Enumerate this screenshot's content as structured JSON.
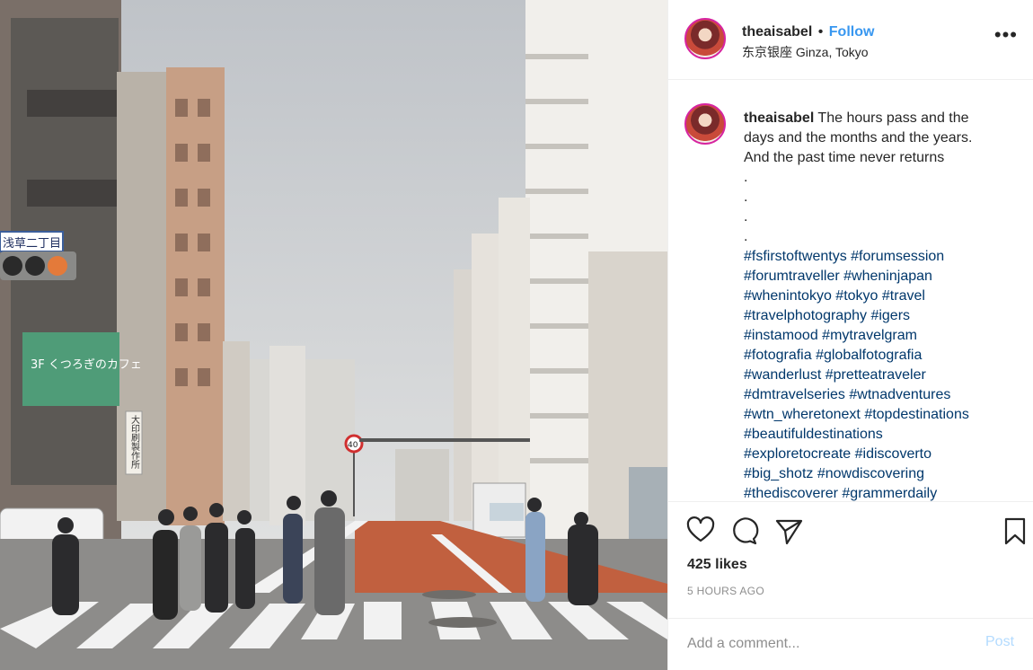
{
  "post": {
    "username": "theaisabel",
    "follow_label": "Follow",
    "separator": "•",
    "location": "东京银座 Ginza, Tokyo",
    "more_glyph": "•••",
    "photo": {
      "street_sign": "浅草二丁目",
      "cafe_sign": "3F くつろぎのカフェ",
      "vertical_sign": "大印刷製作所",
      "speed_sign": "40"
    },
    "caption": {
      "username": "theaisabel",
      "lines": [
        "The hours pass and the",
        "days and the months and the years.",
        "And the past time never returns",
        ".",
        ".",
        ".",
        "."
      ],
      "hashtag_lines": [
        [
          "#fsfirstoftwentys",
          "#forumsession"
        ],
        [
          "#forumtraveller",
          "#wheninjapan"
        ],
        [
          "#whenintokyo",
          "#tokyo",
          "#travel"
        ],
        [
          "#travelphotography",
          "#igers"
        ],
        [
          "#instamood",
          "#mytravelgram"
        ],
        [
          "#fotografia",
          "#globalfotografia"
        ],
        [
          "#wanderlust",
          "#pretteatraveler"
        ],
        [
          "#dmtravelseries",
          "#wtnadventures"
        ],
        [
          "#wtn_wheretonext",
          "#topdestinations"
        ],
        [
          "#beautifuldestinations"
        ],
        [
          "#exploretocreate",
          "#idiscoverto"
        ],
        [
          "#big_shotz",
          "#nowdiscovering"
        ],
        [
          "#thediscoverer",
          "#grammerdaily"
        ]
      ]
    },
    "likes": "425 likes",
    "time_ago": "5 HOURS AGO",
    "comment": {
      "placeholder": "Add a comment...",
      "post_label": "Post"
    }
  },
  "icons": [
    "like-heart-icon",
    "comment-bubble-icon",
    "share-paper-plane-icon",
    "save-bookmark-icon",
    "more-options-icon"
  ],
  "colors": {
    "link_blue": "#3897f0",
    "hashtag": "#00376b",
    "muted": "#8e8e8e",
    "post_disabled": "#b3dbff",
    "border": "#efefef",
    "road_red": "#c1603f"
  }
}
